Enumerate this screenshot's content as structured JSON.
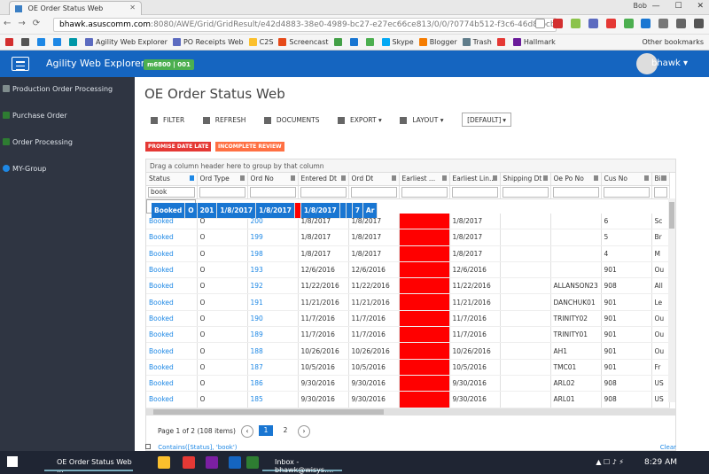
{
  "browser": {
    "tab_title": "OE Order Status Web",
    "profile": "Bob",
    "url_host": "bhawk.asuscomm.com",
    "url_path": ":8080/AWE/Grid/GridResult/e42d4883-38e0-4989-bc27-e27ec66ce813/0/0/?0774b512-f3c6-46d8-bcb2-3",
    "bookmarks": [
      {
        "label": "",
        "color": "#d32f2f"
      },
      {
        "label": "",
        "color": "#555555"
      },
      {
        "label": "",
        "color": "#1e88e5"
      },
      {
        "label": "",
        "color": "#1e88e5"
      },
      {
        "label": "",
        "color": "#0097a7"
      },
      {
        "label": "Agility Web Explorer",
        "color": "#5c6bc0"
      },
      {
        "label": "PO Receipts Web",
        "color": "#5c6bc0"
      },
      {
        "label": "C2S",
        "color": "#fbc02d"
      },
      {
        "label": "Screencast",
        "color": "#e64a19"
      },
      {
        "label": "",
        "color": "#43a047"
      },
      {
        "label": "",
        "color": "#1976d2"
      },
      {
        "label": "",
        "color": "#4caf50"
      },
      {
        "label": "Skype",
        "color": "#03a9f4"
      },
      {
        "label": "Blogger",
        "color": "#f57c00"
      },
      {
        "label": "Trash",
        "color": "#607d8b"
      },
      {
        "label": "",
        "color": "#e53935"
      },
      {
        "label": "Hallmark",
        "color": "#6a1b9a"
      }
    ],
    "other_bookmarks": "Other bookmarks"
  },
  "app": {
    "title": "Agility Web Explorer",
    "badge": "m6800 | 001",
    "user": "bhawk"
  },
  "sidebar": {
    "items": [
      {
        "label": "Production Order Processing"
      },
      {
        "label": "Purchase Order"
      },
      {
        "label": "Order Processing"
      },
      {
        "label": "MY-Group"
      }
    ]
  },
  "page": {
    "title": "OE Order Status Web",
    "toolbar": {
      "filter": "FILTER",
      "refresh": "REFRESH",
      "documents": "DOCUMENTS",
      "export": "EXPORT",
      "layout": "LAYOUT",
      "layout_select": "[DEFAULT]"
    },
    "tags": [
      "PROMISE DATE LATE",
      "INCOMPLETE REVIEW"
    ],
    "group_hint": "Drag a column header here to group by that column"
  },
  "grid": {
    "columns": [
      "Status",
      "Ord Type",
      "Ord No",
      "Entered Dt",
      "Ord Dt",
      "Earliest ...",
      "Earliest Lin...",
      "Shipping Dt",
      "Oe Po No",
      "Cus No",
      "Bil"
    ],
    "status_filter": "book",
    "rows": [
      {
        "status": "Booked",
        "type": "O",
        "no": "201",
        "entered": "1/8/2017",
        "ord": "1/8/2017",
        "line": "1/8/2017",
        "ship": "",
        "po": "",
        "cus": "7",
        "bil": "Ar"
      },
      {
        "status": "Booked",
        "type": "O",
        "no": "200",
        "entered": "1/8/2017",
        "ord": "1/8/2017",
        "line": "1/8/2017",
        "ship": "",
        "po": "",
        "cus": "6",
        "bil": "Sc"
      },
      {
        "status": "Booked",
        "type": "O",
        "no": "199",
        "entered": "1/8/2017",
        "ord": "1/8/2017",
        "line": "1/8/2017",
        "ship": "",
        "po": "",
        "cus": "5",
        "bil": "Br"
      },
      {
        "status": "Booked",
        "type": "O",
        "no": "198",
        "entered": "1/8/2017",
        "ord": "1/8/2017",
        "line": "1/8/2017",
        "ship": "",
        "po": "",
        "cus": "4",
        "bil": "M"
      },
      {
        "status": "Booked",
        "type": "O",
        "no": "193",
        "entered": "12/6/2016",
        "ord": "12/6/2016",
        "line": "12/6/2016",
        "ship": "",
        "po": "",
        "cus": "901",
        "bil": "Ou"
      },
      {
        "status": "Booked",
        "type": "O",
        "no": "192",
        "entered": "11/22/2016",
        "ord": "11/22/2016",
        "line": "11/22/2016",
        "ship": "",
        "po": "ALLANSON23",
        "cus": "908",
        "bil": "All"
      },
      {
        "status": "Booked",
        "type": "O",
        "no": "191",
        "entered": "11/21/2016",
        "ord": "11/21/2016",
        "line": "11/21/2016",
        "ship": "",
        "po": "DANCHUK01",
        "cus": "901",
        "bil": "Le"
      },
      {
        "status": "Booked",
        "type": "O",
        "no": "190",
        "entered": "11/7/2016",
        "ord": "11/7/2016",
        "line": "11/7/2016",
        "ship": "",
        "po": "TRINITY02",
        "cus": "901",
        "bil": "Ou"
      },
      {
        "status": "Booked",
        "type": "O",
        "no": "189",
        "entered": "11/7/2016",
        "ord": "11/7/2016",
        "line": "11/7/2016",
        "ship": "",
        "po": "TRINITY01",
        "cus": "901",
        "bil": "Ou"
      },
      {
        "status": "Booked",
        "type": "O",
        "no": "188",
        "entered": "10/26/2016",
        "ord": "10/26/2016",
        "line": "10/26/2016",
        "ship": "",
        "po": "AH1",
        "cus": "901",
        "bil": "Ou"
      },
      {
        "status": "Booked",
        "type": "O",
        "no": "187",
        "entered": "10/5/2016",
        "ord": "10/5/2016",
        "line": "10/5/2016",
        "ship": "",
        "po": "TMC01",
        "cus": "901",
        "bil": "Fr"
      },
      {
        "status": "Booked",
        "type": "O",
        "no": "186",
        "entered": "9/30/2016",
        "ord": "9/30/2016",
        "line": "9/30/2016",
        "ship": "",
        "po": "ARL02",
        "cus": "908",
        "bil": "US"
      },
      {
        "status": "Booked",
        "type": "O",
        "no": "185",
        "entered": "9/30/2016",
        "ord": "9/30/2016",
        "line": "9/30/2016",
        "ship": "",
        "po": "ARL01",
        "cus": "908",
        "bil": "US"
      }
    ],
    "highlight_color": "#ff0000",
    "selected_color": "#1976d2"
  },
  "pager": {
    "summary": "Page 1 of 2 (108 items)",
    "pages": [
      "1",
      "2"
    ]
  },
  "footer": {
    "filter_expr": "Contains([Status], 'book')",
    "clear": "Clear"
  },
  "taskbar": {
    "app1": "OE Order Status Web ...",
    "app2": "Inbox - bhawk@wisys....",
    "time": "8:29 AM"
  }
}
